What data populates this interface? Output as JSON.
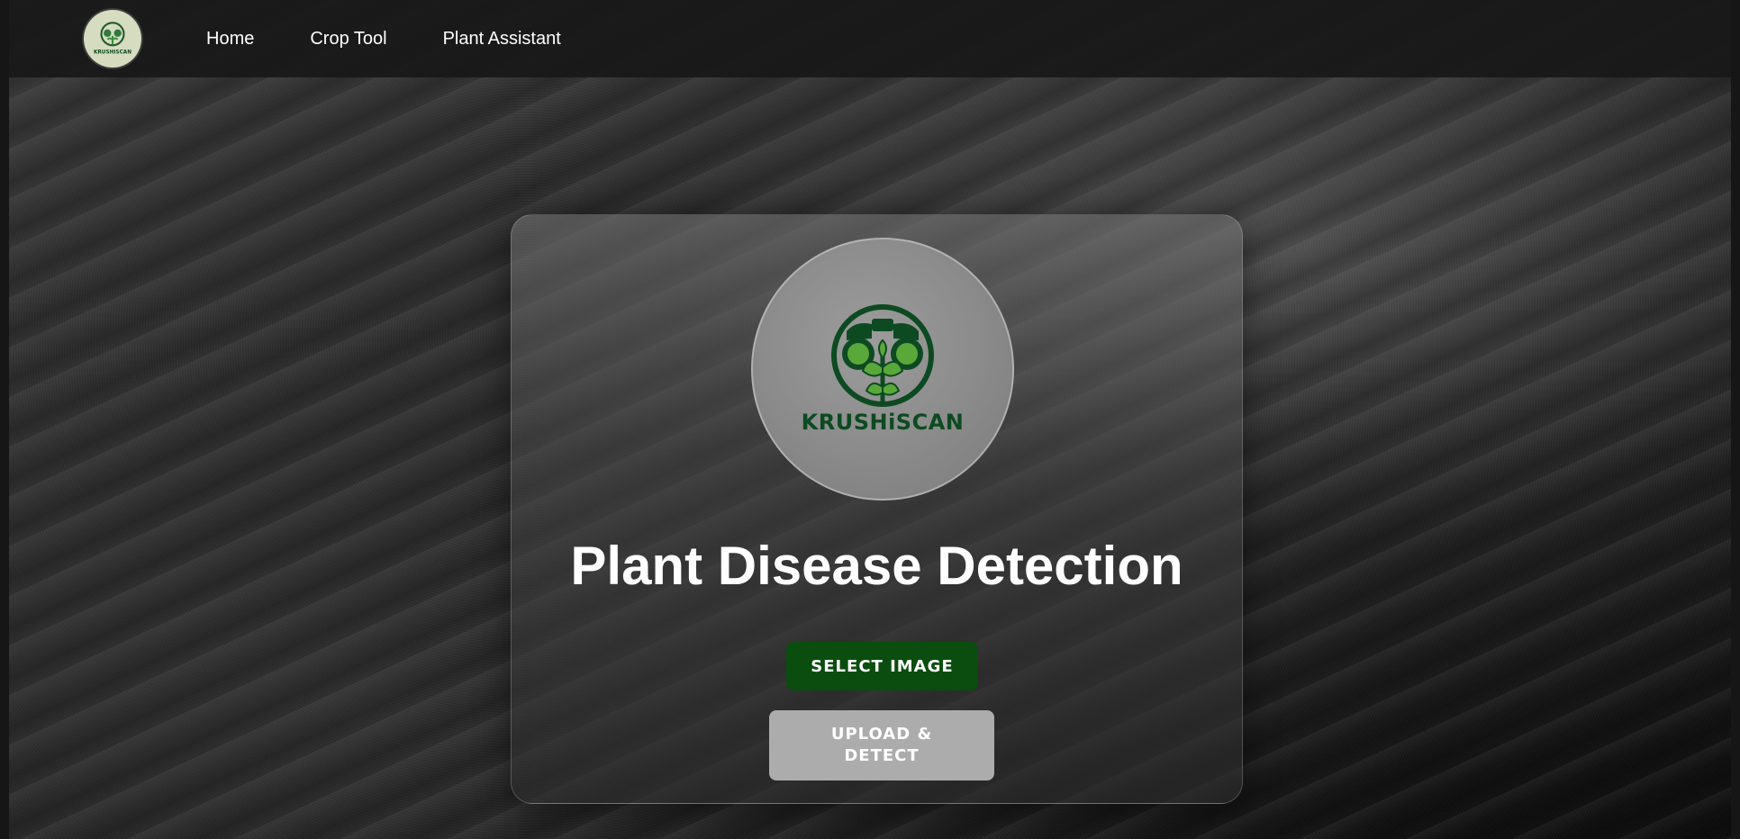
{
  "nav": {
    "logo_text": "KRUSHISCAN",
    "links": [
      {
        "label": "Home"
      },
      {
        "label": "Crop Tool"
      },
      {
        "label": "Plant Assistant"
      }
    ]
  },
  "card": {
    "logo_text": "KRUSHiSCAN",
    "title": "Plant Disease Detection",
    "select_button": "SELECT IMAGE",
    "upload_button": "UPLOAD & DETECT"
  },
  "colors": {
    "brand_green": "#0a4d0e",
    "logo_green": "#0d4a21",
    "leaf_green": "#5aa83a",
    "disabled_gray": "#acacac"
  }
}
